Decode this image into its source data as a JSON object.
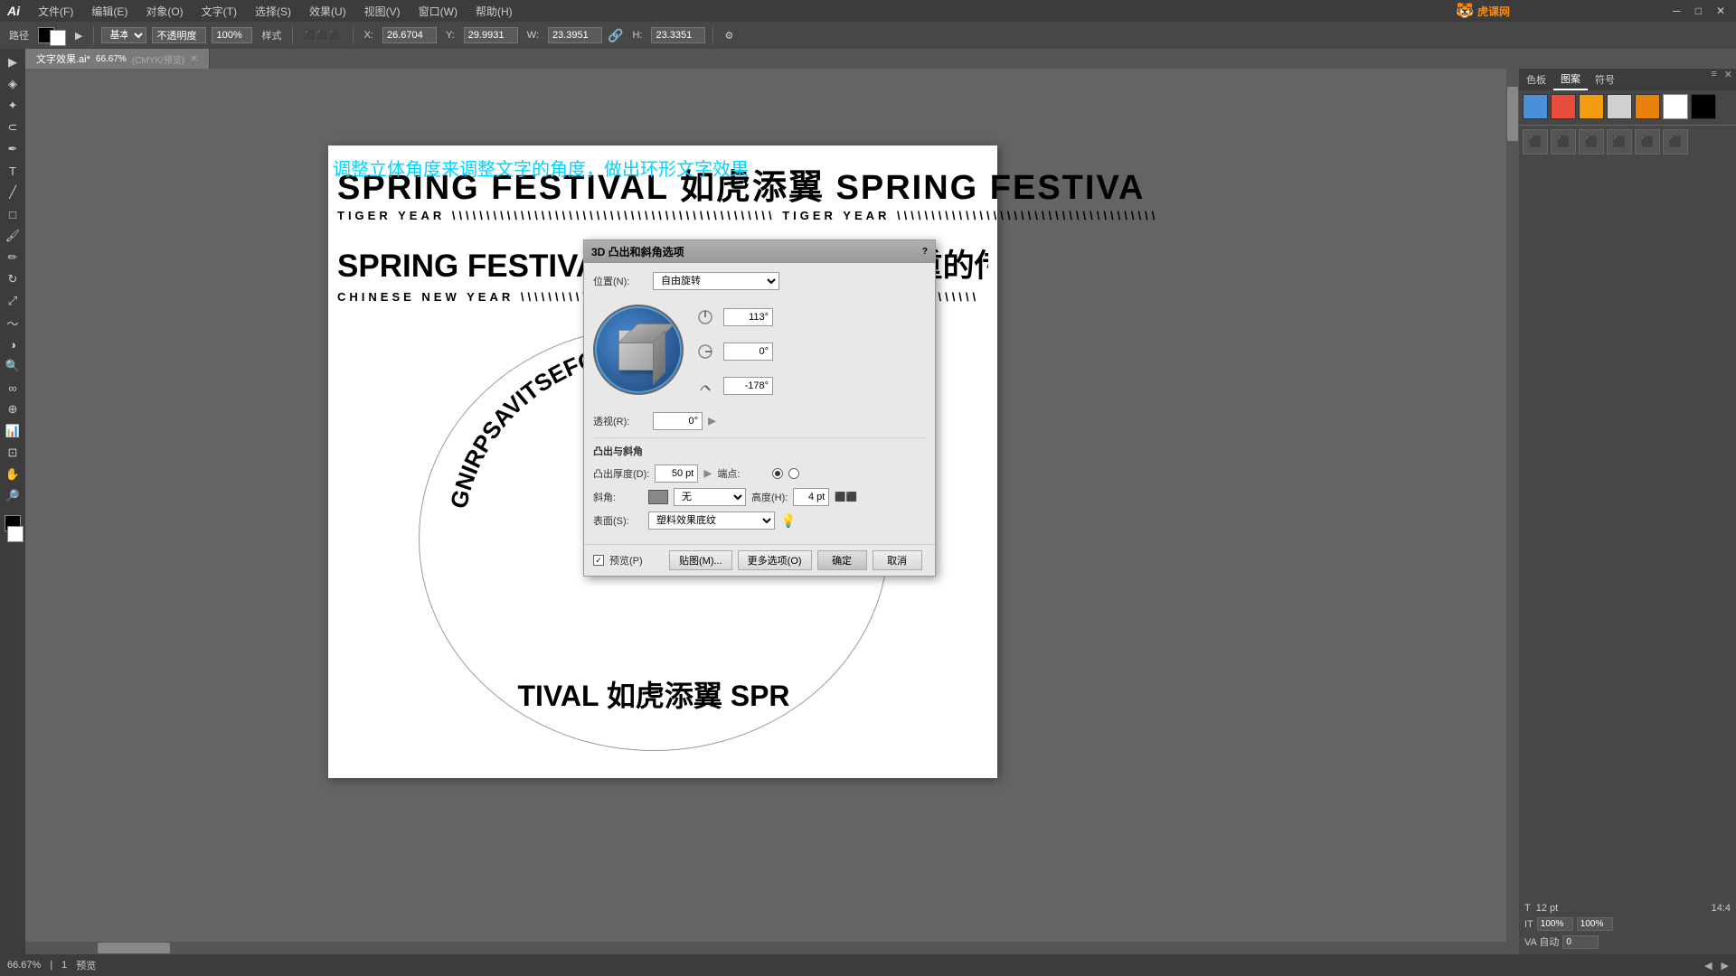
{
  "app": {
    "name": "Ai",
    "title": "Adobe Illustrator"
  },
  "menu": {
    "items": [
      "文件(F)",
      "编辑(E)",
      "对象(O)",
      "文字(T)",
      "选择(S)",
      "效果(U)",
      "视图(V)",
      "窗口(W)",
      "帮助(H)"
    ]
  },
  "toolbar": {
    "mode": "路径",
    "fill": "基本",
    "opacity_label": "不透明度",
    "opacity_value": "100%",
    "style_label": "样式",
    "x_label": "X:",
    "x_value": "26.6704",
    "y_label": "Y:",
    "y_value": "29.9931",
    "w_label": "W:",
    "w_value": "23.3951",
    "h_label": "H:",
    "h_value": "23.3351"
  },
  "tab": {
    "label": "文字效果.ai*",
    "zoom": "66.67%",
    "mode": "CMYK/预览"
  },
  "annotation": {
    "text": "调整立体角度来调整文字的角度，做出环形文字效果"
  },
  "artboard": {
    "line1": "SPRING FESTIVAL 如虎添翼 SPRING FESTIVA",
    "line2": "TIGER YEAR \\\\\\\\\\\\\\\\\\\\\\\\\\\\\\\\ TIGER YEAR \\\\\\\\\\\\\\\\\\\\\\\\\\\\\\\\",
    "line3": "SPRING FESTIVAL 春节是中华民族最隆重的传统佳节",
    "line4": "CHINESE NEW YEAR \\\\\\\\\\\\\\\\\\\\\\\\ CHINESE NEW YEAR \\\\\\\\\\",
    "circle_text_top": "GNIRPSAVITSEFGNI",
    "circle_text_bottom": "TIVAL 如虎添翼 SPR"
  },
  "dialog_3d": {
    "title": "3D 凸出和斜角选项",
    "position_label": "位置(N):",
    "position_value": "自由旋转",
    "angle1_value": "113°",
    "angle2_value": "0°",
    "angle3_value": "-178°",
    "perspective_label": "透视(R):",
    "perspective_value": "0°",
    "convex_title": "凸出与斜角",
    "depth_label": "凸出厚度(D):",
    "depth_value": "50 pt",
    "cap_label": "端点:",
    "bevel_label": "斜角:",
    "bevel_value": "无",
    "height_label": "高度(H):",
    "height_value": "4 pt",
    "surface_label": "表面(S):",
    "surface_value": "塑料效果底纹",
    "preview_label": "预览(P)",
    "map_btn": "贴图(M)...",
    "options_btn": "更多选项(O)",
    "ok_btn": "确定",
    "cancel_btn": "取消"
  },
  "colors": {
    "cyan_arrow": "#00d4ff",
    "artboard_bg": "#ffffff",
    "canvas_bg": "#646464",
    "dialog_bg": "#e8e8e8",
    "text_primary": "#000000",
    "annotation_color": "#00d4ff"
  },
  "status_bar": {
    "zoom": "66.67%",
    "page": "1",
    "mode": "预览"
  }
}
